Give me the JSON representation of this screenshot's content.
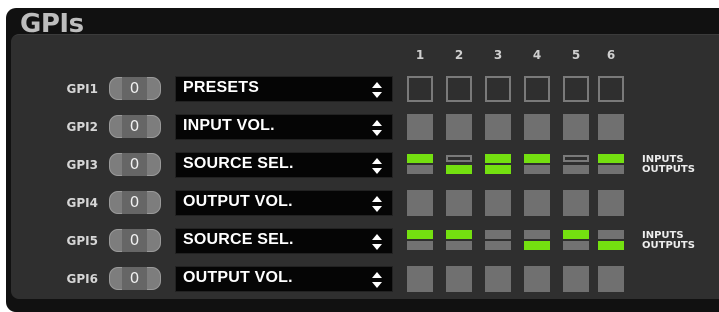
{
  "title": "GPIs",
  "columns": [
    "1",
    "2",
    "3",
    "4",
    "5",
    "6"
  ],
  "io_labels": {
    "inputs": "INPUTS",
    "outputs": "OUTPUTS"
  },
  "colors": {
    "green": "#74e010",
    "gray": "#727272"
  },
  "rows": [
    {
      "label": "GPI1",
      "value": "0",
      "function": "PRESETS",
      "cells": "outline"
    },
    {
      "label": "GPI2",
      "value": "0",
      "function": "INPUT VOL.",
      "cells": "plain"
    },
    {
      "label": "GPI3",
      "value": "0",
      "function": "SOURCE SEL.",
      "cells": "io",
      "inputs": [
        "green",
        "hollow",
        "green",
        "green",
        "hollow",
        "green"
      ],
      "outputs": [
        "gray",
        "green",
        "green",
        "gray",
        "gray",
        "gray"
      ]
    },
    {
      "label": "GPI4",
      "value": "0",
      "function": "OUTPUT VOL.",
      "cells": "plain"
    },
    {
      "label": "GPI5",
      "value": "0",
      "function": "SOURCE SEL.",
      "cells": "io",
      "inputs": [
        "green",
        "green",
        "gray",
        "gray",
        "green",
        "gray"
      ],
      "outputs": [
        "gray",
        "gray",
        "gray",
        "green",
        "gray",
        "green"
      ]
    },
    {
      "label": "GPI6",
      "value": "0",
      "function": "OUTPUT VOL.",
      "cells": "plain"
    }
  ]
}
